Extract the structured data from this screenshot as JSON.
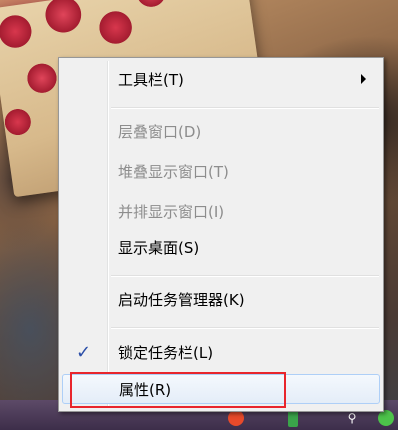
{
  "menu": {
    "items": [
      {
        "label": "工具栏(T)",
        "enabled": true,
        "has_submenu": true
      },
      {
        "label": "层叠窗口(D)",
        "enabled": false
      },
      {
        "label": "堆叠显示窗口(T)",
        "enabled": false
      },
      {
        "label": "并排显示窗口(I)",
        "enabled": false
      },
      {
        "label": "显示桌面(S)",
        "enabled": true
      },
      {
        "label": "启动任务管理器(K)",
        "enabled": true
      },
      {
        "label": "锁定任务栏(L)",
        "enabled": true,
        "checked": true
      },
      {
        "label": "属性(R)",
        "enabled": true,
        "hovered": true
      }
    ],
    "check_glyph": "✓"
  },
  "icons": {
    "submenu_arrow": "chevron-right-icon",
    "check": "check-icon"
  },
  "colors": {
    "highlight_border": "#e8252c",
    "hover_fill": "#e4edf8",
    "disabled_text": "#8d8d8d"
  }
}
